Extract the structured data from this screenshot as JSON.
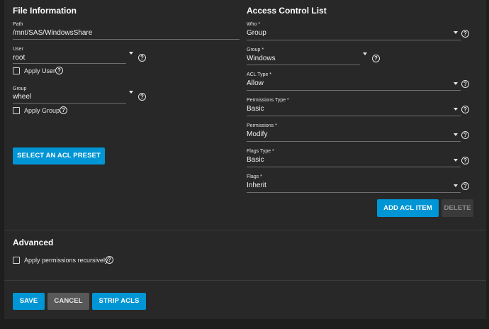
{
  "file_info": {
    "title": "File Information",
    "path_label": "Path",
    "path_value": "/mnt/SAS/WindowsShare",
    "user_label": "User",
    "user_value": "root",
    "apply_user_label": "Apply User",
    "group_label": "Group",
    "group_value": "wheel",
    "apply_group_label": "Apply Group",
    "preset_button": "SELECT AN ACL PRESET"
  },
  "acl": {
    "title": "Access Control List",
    "who_label": "Who *",
    "who_value": "Group",
    "group_label": "Group *",
    "group_value": "Windows",
    "acl_type_label": "ACL Type *",
    "acl_type_value": "Allow",
    "perm_type_label": "Permissions Type *",
    "perm_type_value": "Basic",
    "perms_label": "Permissions *",
    "perms_value": "Modify",
    "flags_type_label": "Flags Type *",
    "flags_type_value": "Basic",
    "flags_label": "Flags *",
    "flags_value": "Inherit",
    "add_button": "ADD ACL ITEM",
    "delete_button": "DELETE"
  },
  "advanced": {
    "title": "Advanced",
    "recursive_label": "Apply permissions recursively"
  },
  "footer": {
    "save": "SAVE",
    "cancel": "CANCEL",
    "strip": "STRIP ACLS"
  },
  "icons": {
    "help": "?"
  },
  "colors": {
    "primary": "#0095d5",
    "background": "#282828",
    "page": "#1e1e1e"
  }
}
